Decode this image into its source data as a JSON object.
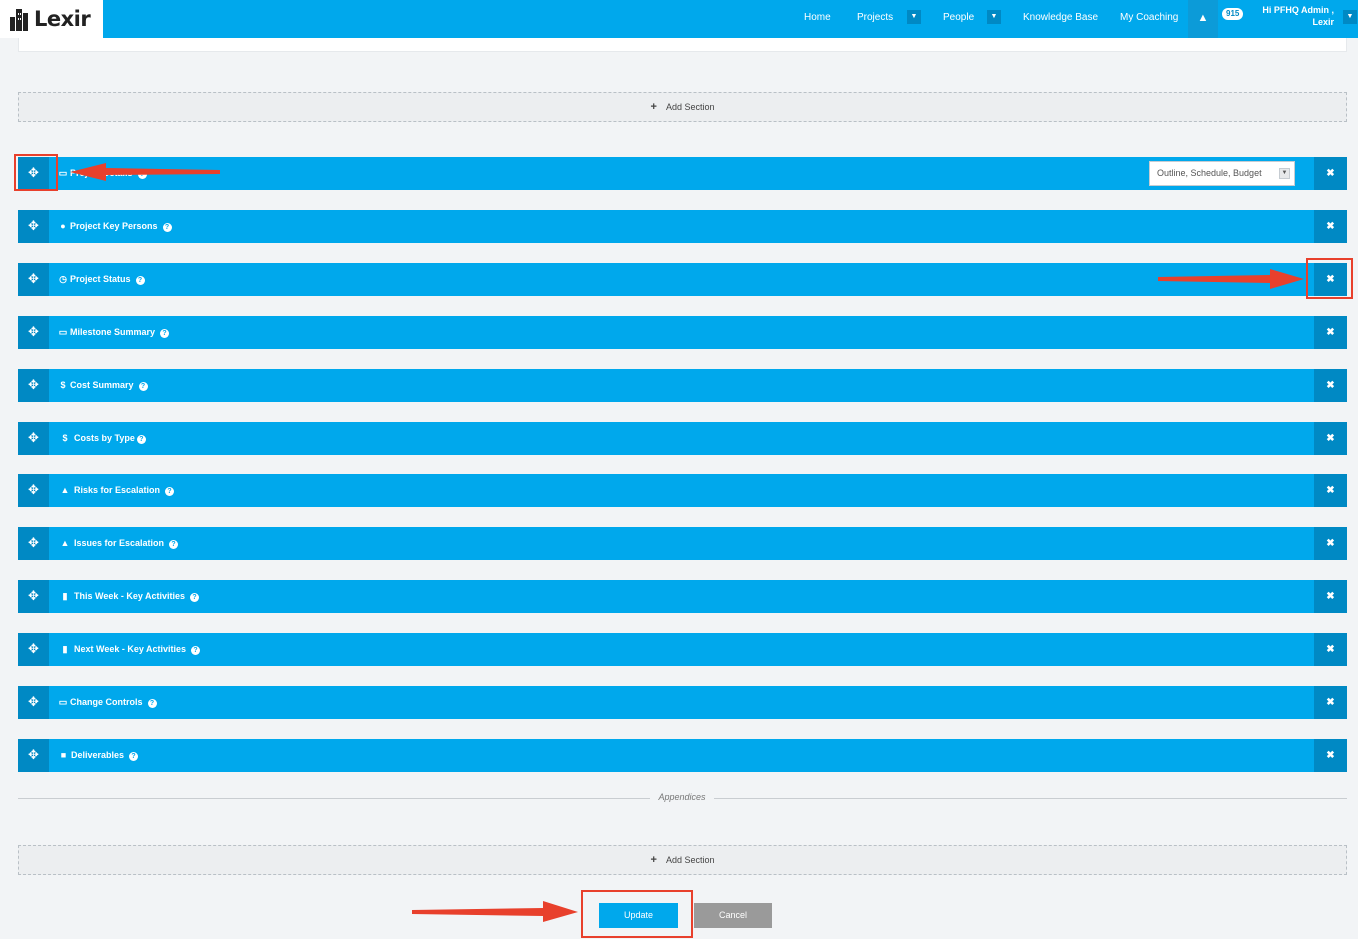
{
  "logo": {
    "text": "Lexir"
  },
  "nav": {
    "home": "Home",
    "projects": "Projects",
    "people": "People",
    "knowledge_base": "Knowledge Base",
    "my_coaching": "My Coaching",
    "notification_count": "915",
    "user_line1": "Hi PFHQ Admin ,",
    "user_line2": "Lexir"
  },
  "add_section_label": "Add Section",
  "sections": [
    {
      "title": "Project Details",
      "icon": "calendar-icon",
      "select_value": "Outline, Schedule, Budget"
    },
    {
      "title": "Project Key Persons",
      "icon": "users-icon"
    },
    {
      "title": "Project Status",
      "icon": "clock-icon"
    },
    {
      "title": "Milestone Summary",
      "icon": "calendar-icon"
    },
    {
      "title": "Cost Summary",
      "icon": "dollar-icon"
    },
    {
      "title": "Costs by Type",
      "icon": "dollar-icon"
    },
    {
      "title": "Risks for Escalation",
      "icon": "warning-icon"
    },
    {
      "title": "Issues for Escalation",
      "icon": "warning-icon"
    },
    {
      "title": "This Week - Key Activities",
      "icon": "bookmark-icon"
    },
    {
      "title": "Next Week - Key Activities",
      "icon": "bookmark-icon"
    },
    {
      "title": "Change Controls",
      "icon": "folder-icon"
    },
    {
      "title": "Deliverables",
      "icon": "truck-icon"
    }
  ],
  "appendices_label": "Appendices",
  "buttons": {
    "update": "Update",
    "cancel": "Cancel"
  },
  "colors": {
    "brand_blue": "#00a8ec",
    "dark_blue": "#0089c4",
    "annotation_red": "#e8402c",
    "cancel_gray": "#9a9a9a"
  }
}
